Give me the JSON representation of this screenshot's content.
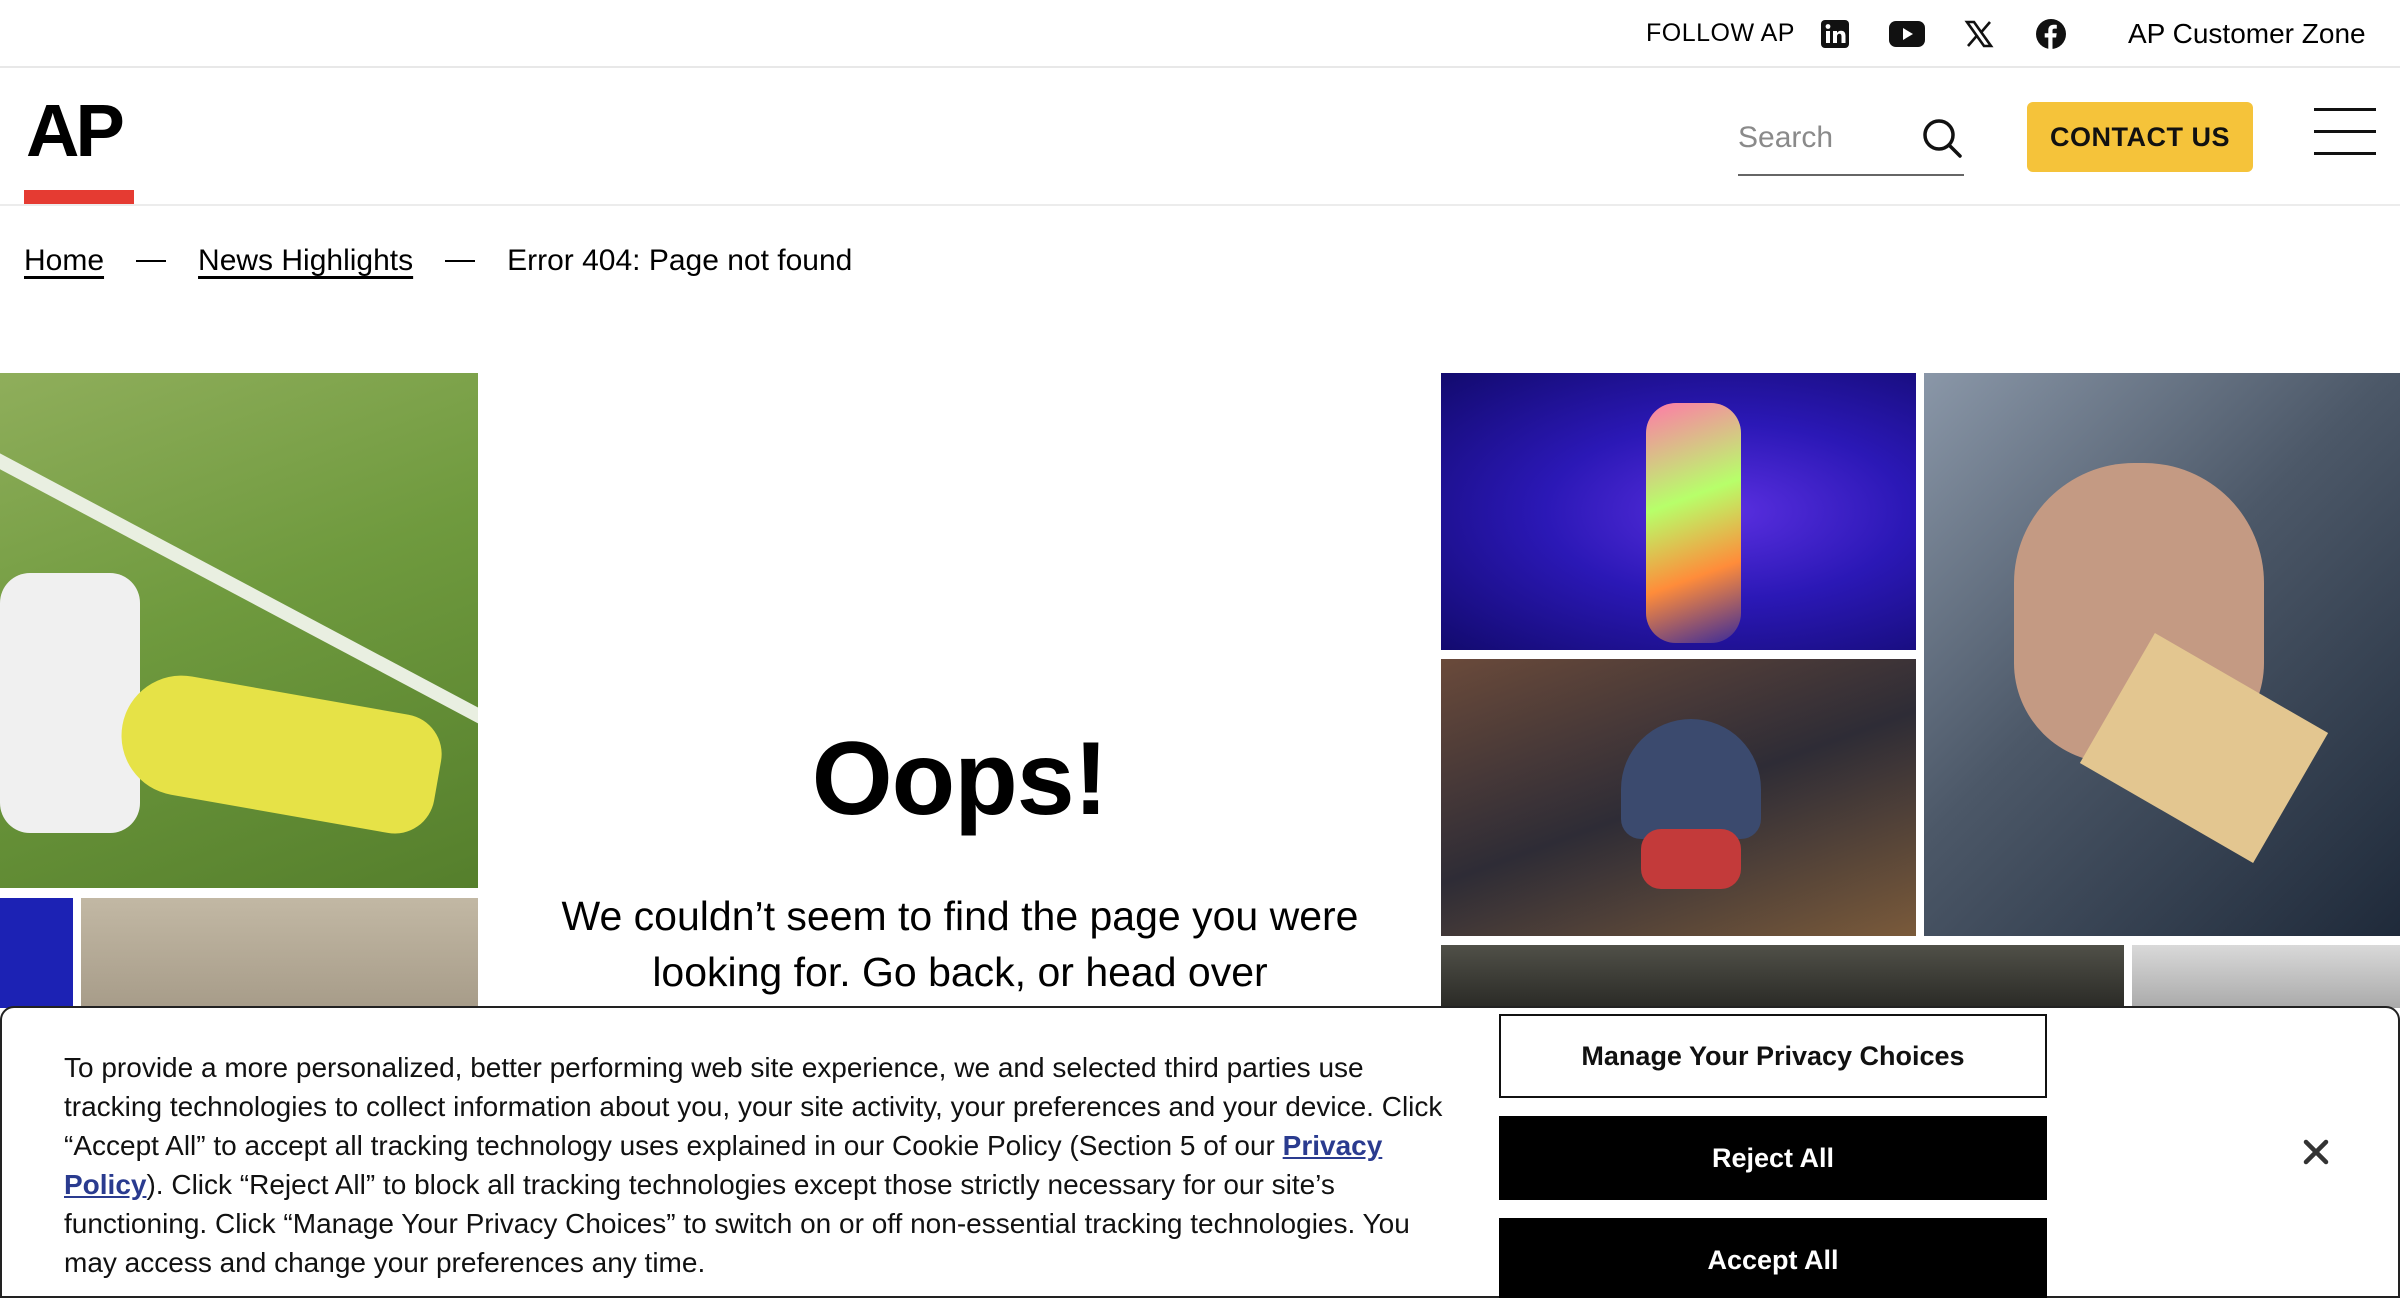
{
  "topbar": {
    "follow_label": "FOLLOW AP",
    "social_icons": [
      "linkedin-icon",
      "youtube-icon",
      "x-icon",
      "facebook-icon"
    ],
    "customer_zone": "AP Customer Zone"
  },
  "header": {
    "logo": "AP",
    "search_placeholder": "Search",
    "contact_label": "CONTACT US",
    "accent_color": "#f5c33a",
    "logo_bar_color": "#e53b32"
  },
  "breadcrumb": {
    "home": "Home",
    "section": "News Highlights",
    "current": "Error 404: Page not found"
  },
  "error": {
    "heading": "Oops!",
    "message": "We couldn’t seem to find the page you were looking for. Go back, or head over"
  },
  "cookie_banner": {
    "text_before_link": "To provide a more personalized, better performing web site experience, we and selected third parties use tracking technologies to collect information about you, your site activity, your preferences and your device. Click “Accept All” to accept all tracking technology uses explained in our Cookie Policy (Section 5 of our ",
    "link_text": "Privacy Policy",
    "text_after_link": "). Click “Reject All” to block all tracking technologies except those strictly necessary for our site’s functioning. Click “Manage Your Privacy Choices” to switch on or off non-essential tracking technologies. You may access and change your preferences any time.",
    "manage_label": "Manage Your Privacy Choices",
    "reject_label": "Reject All",
    "accept_label": "Accept All"
  }
}
